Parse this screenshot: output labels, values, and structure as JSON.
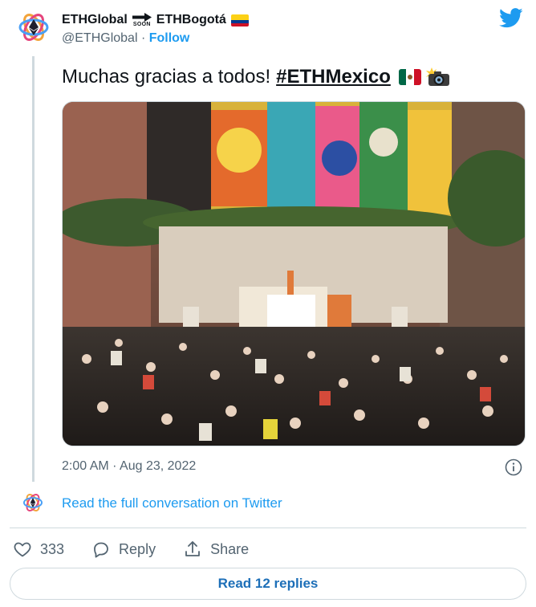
{
  "author": {
    "display_name_left": "ETHGlobal",
    "soon_label": "SOON",
    "display_name_right": "ETHBogotá",
    "handle": "@ETHGlobal",
    "separator": " · ",
    "follow_label": "Follow"
  },
  "tweet": {
    "text": "Muchas gracias a todos!",
    "hashtag": "#ETHMexico",
    "timestamp": "2:00 AM · Aug 23, 2022"
  },
  "conversation_link": "Read the full conversation on Twitter",
  "actions": {
    "like_count": "333",
    "reply_label": "Reply",
    "share_label": "Share"
  },
  "read_replies_label": "Read 12 replies",
  "colors": {
    "accent": "#1d9bf0",
    "text": "#0f1419",
    "muted": "#536471",
    "border": "#cfd9de"
  },
  "icons": [
    "ethglobal-logo-icon",
    "arrow-right-icon",
    "colombia-flag-icon",
    "twitter-bird-icon",
    "mexico-flag-icon",
    "camera-flash-icon",
    "info-icon",
    "heart-icon",
    "reply-bubble-icon",
    "share-icon"
  ]
}
